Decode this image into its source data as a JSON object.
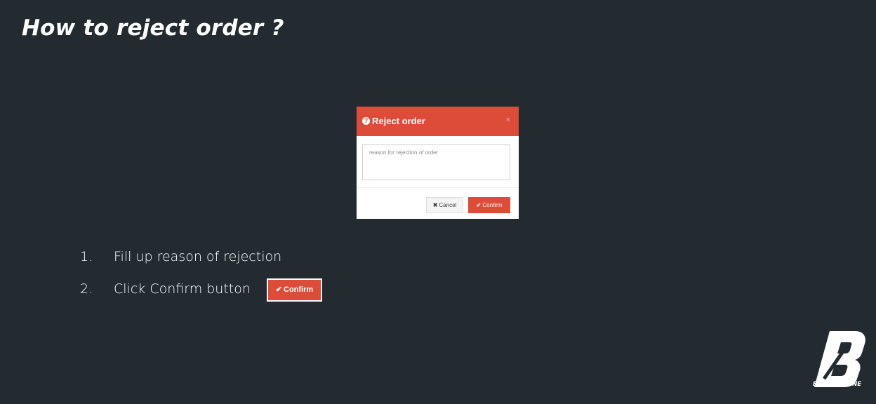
{
  "slide": {
    "title": "How to reject order ?"
  },
  "modal": {
    "title": "Reject order",
    "header_icon": "question-circle-icon",
    "close_icon": "close-icon",
    "close_glyph": "×",
    "reason_placeholder": "reason for rejection of order",
    "reason_value": "",
    "cancel_label": "Cancel",
    "cancel_icon": "times-icon",
    "cancel_glyph": "✖",
    "confirm_label": "Confirm",
    "confirm_icon": "check-icon",
    "confirm_glyph": "✔"
  },
  "steps": [
    {
      "number": "1.",
      "text": "Fill up reason of rejection"
    },
    {
      "number": "2.",
      "text": "Click Confirm button"
    }
  ],
  "inline_button": {
    "label": "Confirm",
    "icon": "check-icon",
    "glyph": "✔"
  },
  "brand": {
    "wordmark": "BRIDGESTONE",
    "logo_icon": "bridgestone-b-logo"
  },
  "colors": {
    "background": "#232b30",
    "accent_red": "#dd4b39",
    "text": "#ffffff"
  }
}
